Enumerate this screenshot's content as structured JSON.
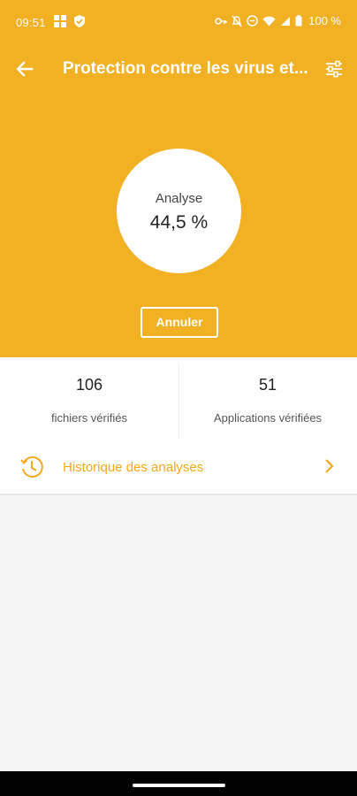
{
  "status_bar": {
    "time": "09:51",
    "battery": "100 %"
  },
  "app_bar": {
    "title": "Protection contre les virus et..."
  },
  "scan": {
    "label": "Analyse",
    "progress_text": "44,5 %",
    "progress_fraction": 0.445
  },
  "actions": {
    "cancel_label": "Annuler"
  },
  "stats": {
    "files": {
      "value": "106",
      "label": "fichiers vérifiés"
    },
    "apps": {
      "value": "51",
      "label": "Applications vérifiées"
    }
  },
  "history": {
    "label": "Historique des analyses"
  },
  "colors": {
    "accent": "#f2b023",
    "accent_text": "#f2a91e",
    "background": "#f5f5f5"
  },
  "icons": {
    "back": "arrow-left-icon",
    "filter": "sliders-icon",
    "history": "clock-history-icon",
    "chevron": "chevron-right-icon"
  }
}
